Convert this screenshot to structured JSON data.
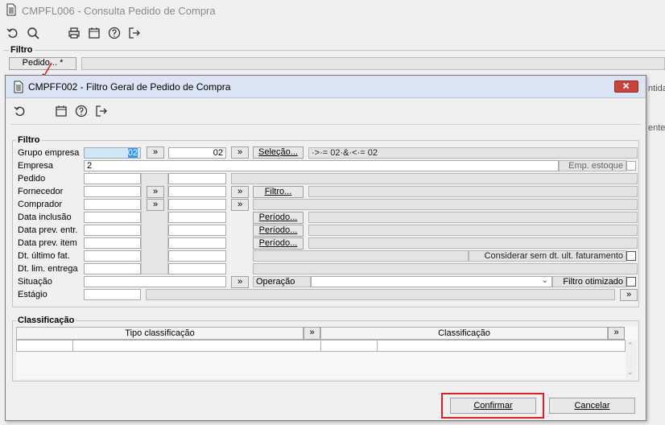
{
  "background": {
    "title": "CMPFL006 - Consulta Pedido de Compra",
    "filtro_label": "Filtro",
    "pedido_button": "Pedido... *",
    "right_fragment_1": "ntida",
    "right_fragment_2": "ente"
  },
  "dialog": {
    "title": "CMPFF002 - Filtro Geral de Pedido de Compra",
    "filtro_section": "Filtro",
    "labels": {
      "grupo_empresa": "Grupo empresa",
      "empresa": "Empresa",
      "pedido": "Pedido",
      "fornecedor": "Fornecedor",
      "comprador": "Comprador",
      "data_inclusao": "Data inclusão",
      "data_prev_entr": "Data prev. entr.",
      "data_prev_item": "Data prev. item",
      "dt_ultimo_fat": "Dt. último fat.",
      "dt_lim_entrega": "Dt. lim. entrega",
      "situacao": "Situação",
      "estagio": "Estágio",
      "operacao": "Operação"
    },
    "values": {
      "grupo_from": "02",
      "grupo_to": "02",
      "selecao_text": "·>·= 02·&·<·= 02",
      "empresa": "2"
    },
    "buttons": {
      "selecao": "Seleção...",
      "filtro": "Filtro...",
      "periodo": "Período...",
      "double_arrow": "»"
    },
    "emp_estoque": "Emp. estoque",
    "considerar_sem_dt": "Considerar sem dt. ult. faturamento",
    "filtro_otimizado": "Filtro otimizado",
    "classificacao_section": "Classificação",
    "columns": {
      "tipo": "Tipo classificação",
      "classificacao": "Classificação"
    },
    "confirmar": "Confirmar",
    "cancelar": "Cancelar"
  },
  "colors": {
    "title_bar": "#dbe4f3",
    "highlight": "#cfe7f7",
    "selection": "#3399ff",
    "confirm_outline": "#e02020",
    "close_button": "#c8433a"
  }
}
